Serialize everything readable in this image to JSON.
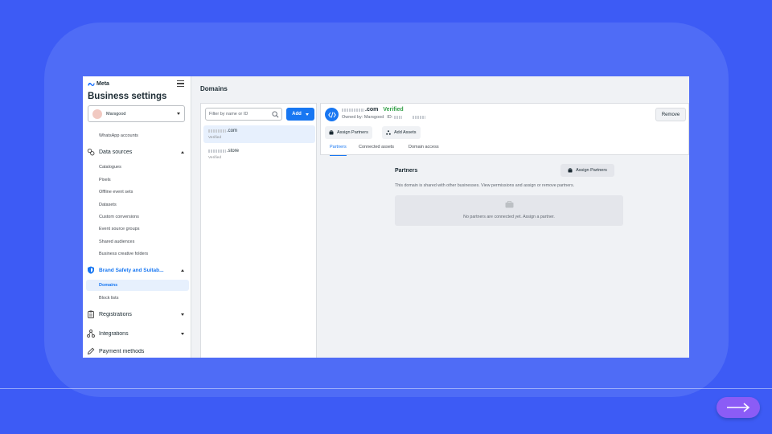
{
  "sidebar": {
    "brand": "Meta",
    "title": "Business settings",
    "account": "Marsgood",
    "items": [
      {
        "label": "WhatsApp accounts"
      },
      {
        "label": "Data sources"
      },
      {
        "label": "Catalogues"
      },
      {
        "label": "Pixels"
      },
      {
        "label": "Offline event sets"
      },
      {
        "label": "Datasets"
      },
      {
        "label": "Custom conversions"
      },
      {
        "label": "Event source groups"
      },
      {
        "label": "Shared audiences"
      },
      {
        "label": "Business creative folders"
      },
      {
        "label": "Brand Safety and Suitab..."
      },
      {
        "label": "Domains"
      },
      {
        "label": "Block lists"
      },
      {
        "label": "Registrations"
      },
      {
        "label": "Integrations"
      },
      {
        "label": "Payment methods"
      }
    ]
  },
  "header": {
    "title": "Domains"
  },
  "list": {
    "filter_placeholder": "Filter by name or ID",
    "add_label": "Add",
    "domains": [
      {
        "suffix": ".com",
        "status": "Verified"
      },
      {
        "suffix": ".store",
        "status": "Verified"
      }
    ]
  },
  "detail": {
    "title_suffix": ".com",
    "verified": "Verified",
    "owner_label": "Owned by: Marsgood",
    "id_label": "ID:",
    "remove_label": "Remove",
    "assign_partners_label": "Assign Partners",
    "add_assets_label": "Add Assets",
    "tabs": [
      "Partners",
      "Connected assets",
      "Domain access"
    ],
    "partners": {
      "title": "Partners",
      "assign_label": "Assign Partners",
      "description": "This domain is shared with other businesses. View permissions and assign or remove partners.",
      "empty_text": "No partners are connected yet. Assign a partner."
    }
  },
  "colors": {
    "page_background": "#3d5bf5",
    "accent": "#1877f2",
    "verified": "#2f9e44",
    "next_button": "#8b5cf6"
  }
}
